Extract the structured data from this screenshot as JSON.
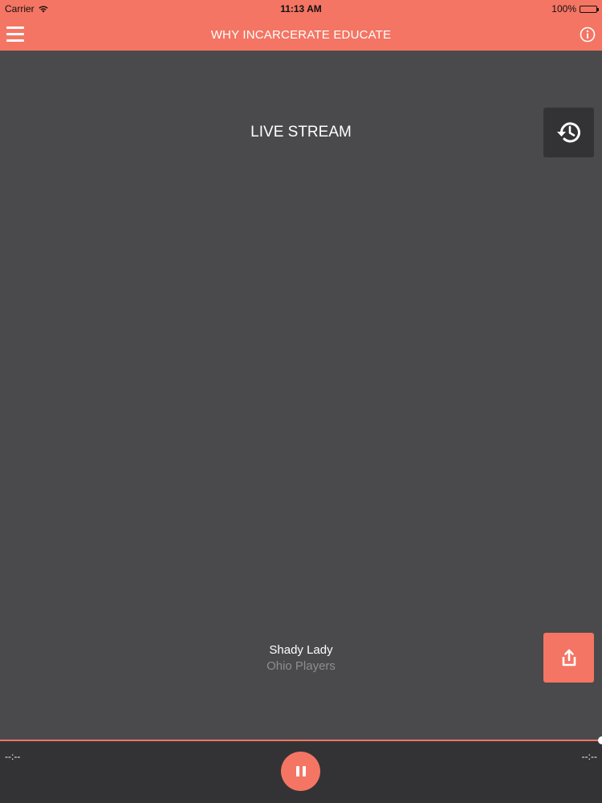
{
  "status_bar": {
    "carrier": "Carrier",
    "time": "11:13 AM",
    "battery": "100%"
  },
  "navbar": {
    "title": "WHY INCARCERATE EDUCATE",
    "menu_icon": "hamburger-menu-icon",
    "info_icon": "info-icon"
  },
  "main": {
    "section_title": "LIVE STREAM",
    "history_icon": "history-clock-icon",
    "share_icon": "share-icon",
    "track": {
      "title": "Shady Lady",
      "artist": "Ohio Players"
    }
  },
  "player": {
    "elapsed": "--:--",
    "remaining": "--:--",
    "progress": 1.0,
    "pause_icon": "pause-icon"
  },
  "colors": {
    "accent": "#f47563",
    "background": "#4a4a4c",
    "dark_panel": "#333335",
    "artist_text": "#8e8e90"
  }
}
